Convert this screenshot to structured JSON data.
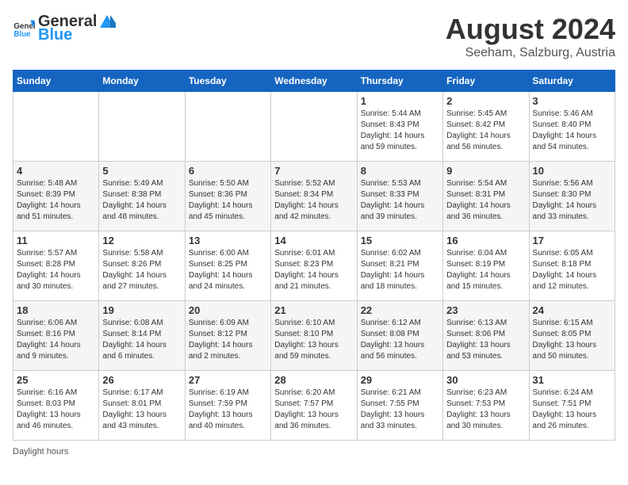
{
  "header": {
    "logo_general": "General",
    "logo_blue": "Blue",
    "month_title": "August 2024",
    "subtitle": "Seeham, Salzburg, Austria"
  },
  "days_of_week": [
    "Sunday",
    "Monday",
    "Tuesday",
    "Wednesday",
    "Thursday",
    "Friday",
    "Saturday"
  ],
  "weeks": [
    [
      {
        "day": "",
        "sunrise": "",
        "sunset": "",
        "daylight": ""
      },
      {
        "day": "",
        "sunrise": "",
        "sunset": "",
        "daylight": ""
      },
      {
        "day": "",
        "sunrise": "",
        "sunset": "",
        "daylight": ""
      },
      {
        "day": "",
        "sunrise": "",
        "sunset": "",
        "daylight": ""
      },
      {
        "day": "1",
        "sunrise": "Sunrise: 5:44 AM",
        "sunset": "Sunset: 8:43 PM",
        "daylight": "Daylight: 14 hours and 59 minutes."
      },
      {
        "day": "2",
        "sunrise": "Sunrise: 5:45 AM",
        "sunset": "Sunset: 8:42 PM",
        "daylight": "Daylight: 14 hours and 56 minutes."
      },
      {
        "day": "3",
        "sunrise": "Sunrise: 5:46 AM",
        "sunset": "Sunset: 8:40 PM",
        "daylight": "Daylight: 14 hours and 54 minutes."
      }
    ],
    [
      {
        "day": "4",
        "sunrise": "Sunrise: 5:48 AM",
        "sunset": "Sunset: 8:39 PM",
        "daylight": "Daylight: 14 hours and 51 minutes."
      },
      {
        "day": "5",
        "sunrise": "Sunrise: 5:49 AM",
        "sunset": "Sunset: 8:38 PM",
        "daylight": "Daylight: 14 hours and 48 minutes."
      },
      {
        "day": "6",
        "sunrise": "Sunrise: 5:50 AM",
        "sunset": "Sunset: 8:36 PM",
        "daylight": "Daylight: 14 hours and 45 minutes."
      },
      {
        "day": "7",
        "sunrise": "Sunrise: 5:52 AM",
        "sunset": "Sunset: 8:34 PM",
        "daylight": "Daylight: 14 hours and 42 minutes."
      },
      {
        "day": "8",
        "sunrise": "Sunrise: 5:53 AM",
        "sunset": "Sunset: 8:33 PM",
        "daylight": "Daylight: 14 hours and 39 minutes."
      },
      {
        "day": "9",
        "sunrise": "Sunrise: 5:54 AM",
        "sunset": "Sunset: 8:31 PM",
        "daylight": "Daylight: 14 hours and 36 minutes."
      },
      {
        "day": "10",
        "sunrise": "Sunrise: 5:56 AM",
        "sunset": "Sunset: 8:30 PM",
        "daylight": "Daylight: 14 hours and 33 minutes."
      }
    ],
    [
      {
        "day": "11",
        "sunrise": "Sunrise: 5:57 AM",
        "sunset": "Sunset: 8:28 PM",
        "daylight": "Daylight: 14 hours and 30 minutes."
      },
      {
        "day": "12",
        "sunrise": "Sunrise: 5:58 AM",
        "sunset": "Sunset: 8:26 PM",
        "daylight": "Daylight: 14 hours and 27 minutes."
      },
      {
        "day": "13",
        "sunrise": "Sunrise: 6:00 AM",
        "sunset": "Sunset: 8:25 PM",
        "daylight": "Daylight: 14 hours and 24 minutes."
      },
      {
        "day": "14",
        "sunrise": "Sunrise: 6:01 AM",
        "sunset": "Sunset: 8:23 PM",
        "daylight": "Daylight: 14 hours and 21 minutes."
      },
      {
        "day": "15",
        "sunrise": "Sunrise: 6:02 AM",
        "sunset": "Sunset: 8:21 PM",
        "daylight": "Daylight: 14 hours and 18 minutes."
      },
      {
        "day": "16",
        "sunrise": "Sunrise: 6:04 AM",
        "sunset": "Sunset: 8:19 PM",
        "daylight": "Daylight: 14 hours and 15 minutes."
      },
      {
        "day": "17",
        "sunrise": "Sunrise: 6:05 AM",
        "sunset": "Sunset: 8:18 PM",
        "daylight": "Daylight: 14 hours and 12 minutes."
      }
    ],
    [
      {
        "day": "18",
        "sunrise": "Sunrise: 6:06 AM",
        "sunset": "Sunset: 8:16 PM",
        "daylight": "Daylight: 14 hours and 9 minutes."
      },
      {
        "day": "19",
        "sunrise": "Sunrise: 6:08 AM",
        "sunset": "Sunset: 8:14 PM",
        "daylight": "Daylight: 14 hours and 6 minutes."
      },
      {
        "day": "20",
        "sunrise": "Sunrise: 6:09 AM",
        "sunset": "Sunset: 8:12 PM",
        "daylight": "Daylight: 14 hours and 2 minutes."
      },
      {
        "day": "21",
        "sunrise": "Sunrise: 6:10 AM",
        "sunset": "Sunset: 8:10 PM",
        "daylight": "Daylight: 13 hours and 59 minutes."
      },
      {
        "day": "22",
        "sunrise": "Sunrise: 6:12 AM",
        "sunset": "Sunset: 8:08 PM",
        "daylight": "Daylight: 13 hours and 56 minutes."
      },
      {
        "day": "23",
        "sunrise": "Sunrise: 6:13 AM",
        "sunset": "Sunset: 8:06 PM",
        "daylight": "Daylight: 13 hours and 53 minutes."
      },
      {
        "day": "24",
        "sunrise": "Sunrise: 6:15 AM",
        "sunset": "Sunset: 8:05 PM",
        "daylight": "Daylight: 13 hours and 50 minutes."
      }
    ],
    [
      {
        "day": "25",
        "sunrise": "Sunrise: 6:16 AM",
        "sunset": "Sunset: 8:03 PM",
        "daylight": "Daylight: 13 hours and 46 minutes."
      },
      {
        "day": "26",
        "sunrise": "Sunrise: 6:17 AM",
        "sunset": "Sunset: 8:01 PM",
        "daylight": "Daylight: 13 hours and 43 minutes."
      },
      {
        "day": "27",
        "sunrise": "Sunrise: 6:19 AM",
        "sunset": "Sunset: 7:59 PM",
        "daylight": "Daylight: 13 hours and 40 minutes."
      },
      {
        "day": "28",
        "sunrise": "Sunrise: 6:20 AM",
        "sunset": "Sunset: 7:57 PM",
        "daylight": "Daylight: 13 hours and 36 minutes."
      },
      {
        "day": "29",
        "sunrise": "Sunrise: 6:21 AM",
        "sunset": "Sunset: 7:55 PM",
        "daylight": "Daylight: 13 hours and 33 minutes."
      },
      {
        "day": "30",
        "sunrise": "Sunrise: 6:23 AM",
        "sunset": "Sunset: 7:53 PM",
        "daylight": "Daylight: 13 hours and 30 minutes."
      },
      {
        "day": "31",
        "sunrise": "Sunrise: 6:24 AM",
        "sunset": "Sunset: 7:51 PM",
        "daylight": "Daylight: 13 hours and 26 minutes."
      }
    ]
  ],
  "footer": {
    "note": "Daylight hours"
  }
}
